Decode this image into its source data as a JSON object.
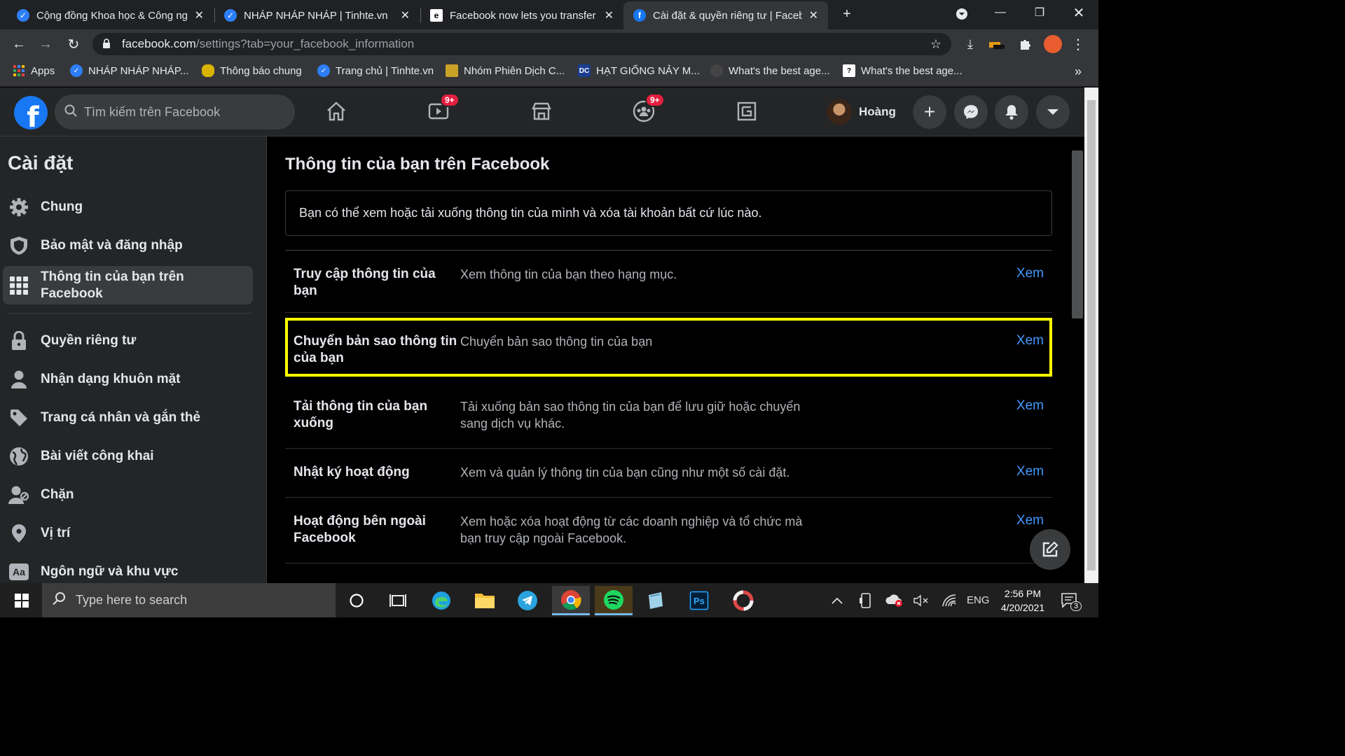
{
  "browser": {
    "tabs": [
      {
        "title": "Cộng đồng Khoa học & Công ng",
        "active": false
      },
      {
        "title": "NHÁP NHÁP NHÁP | Tinhte.vn",
        "active": false
      },
      {
        "title": "Facebook now lets you transfer p",
        "active": false
      },
      {
        "title": "Cài đặt & quyền riêng tư | Faceb",
        "active": true
      }
    ],
    "url_host": "facebook.com",
    "url_path": "/settings?tab=your_facebook_information",
    "bookmarks": [
      "Apps",
      "NHÁP NHÁP NHÁP...",
      "Thông báo chung",
      "Trang chủ | Tinhte.vn",
      "Nhóm Phiên Dịch C...",
      "HẠT GIỐNG NẢY M...",
      "What's the best age...",
      "What's the best age..."
    ]
  },
  "fb": {
    "search_placeholder": "Tìm kiếm trên Facebook",
    "watch_badge": "9+",
    "groups_badge": "9+",
    "profile_name": "Hoàng"
  },
  "sidebar": {
    "title": "Cài đặt",
    "items": [
      {
        "label": "Chung",
        "icon": "gear-icon"
      },
      {
        "label": "Bảo mật và đăng nhập",
        "icon": "shield-icon"
      },
      {
        "label": "Thông tin của bạn trên Facebook",
        "icon": "grid-icon",
        "active": true
      },
      {
        "label": "Quyền riêng tư",
        "icon": "lock-icon"
      },
      {
        "label": "Nhận dạng khuôn mặt",
        "icon": "person-icon"
      },
      {
        "label": "Trang cá nhân và gắn thẻ",
        "icon": "tag-icon"
      },
      {
        "label": "Bài viết công khai",
        "icon": "globe-icon"
      },
      {
        "label": "Chặn",
        "icon": "block-user-icon"
      },
      {
        "label": "Vị trí",
        "icon": "location-pin-icon"
      },
      {
        "label": "Ngôn ngữ và khu vực",
        "icon": "language-icon"
      }
    ]
  },
  "main": {
    "title": "Thông tin của bạn trên Facebook",
    "intro": "Bạn có thể xem hoặc tải xuống thông tin của mình và xóa tài khoản bất cứ lúc nào.",
    "rows": [
      {
        "label": "Truy cập thông tin của bạn",
        "desc": "Xem thông tin của bạn theo hạng mục.",
        "link": "Xem"
      },
      {
        "label": "Chuyển bản sao thông tin của bạn",
        "desc": "Chuyển bản sao thông tin của bạn",
        "link": "Xem",
        "highlighted": true
      },
      {
        "label": "Tải thông tin của bạn xuống",
        "desc": "Tải xuống bản sao thông tin của bạn để lưu giữ hoặc chuyển sang dịch vụ khác.",
        "link": "Xem"
      },
      {
        "label": "Nhật ký hoạt động",
        "desc": "Xem và quản lý thông tin của bạn cũng như một số cài đặt.",
        "link": "Xem"
      },
      {
        "label": "Hoạt động bên ngoài Facebook",
        "desc": "Xem hoặc xóa hoạt động từ các doanh nghiệp và tổ chức mà bạn truy cập ngoài Facebook.",
        "link": "Xem"
      }
    ]
  },
  "taskbar": {
    "search_placeholder": "Type here to search",
    "lang": "ENG",
    "time": "2:56 PM",
    "date": "4/20/2021",
    "notif_count": "3"
  },
  "colors": {
    "fb_blue": "#1877f2",
    "link": "#4599ff",
    "highlight": "#ffff00"
  }
}
